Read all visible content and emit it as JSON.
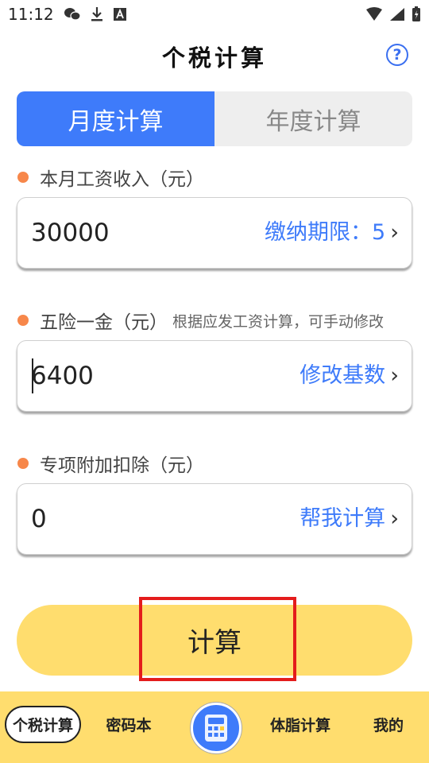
{
  "status": {
    "time": "11:12"
  },
  "app": {
    "title": "个税计算",
    "help": "?"
  },
  "tabs": [
    {
      "label": "月度计算",
      "active": true
    },
    {
      "label": "年度计算",
      "active": false
    }
  ],
  "fields": {
    "salary": {
      "label": "本月工资收入（元）",
      "value": "30000",
      "action": "缴纳期限：5"
    },
    "insurance": {
      "label": "五险一金（元）",
      "hint": "根据应发工资计算，可手动修改",
      "value": "6400",
      "action": "修改基数"
    },
    "deduction": {
      "label": "专项附加扣除（元）",
      "value": "0",
      "action": "帮我计算"
    }
  },
  "calculate_button": "计算",
  "nav": [
    {
      "label": "个税计算",
      "icon": "tax-icon"
    },
    {
      "label": "密码本",
      "icon": "password-book-icon"
    },
    {
      "label": "",
      "icon": "calculator-icon"
    },
    {
      "label": "体脂计算",
      "icon": "body-fat-icon"
    },
    {
      "label": "我的",
      "icon": "profile-icon"
    }
  ],
  "colors": {
    "accent": "#3e7bfa",
    "yellow": "#ffdd6e",
    "dot": "#f7874a",
    "highlight": "#e41c1c"
  }
}
